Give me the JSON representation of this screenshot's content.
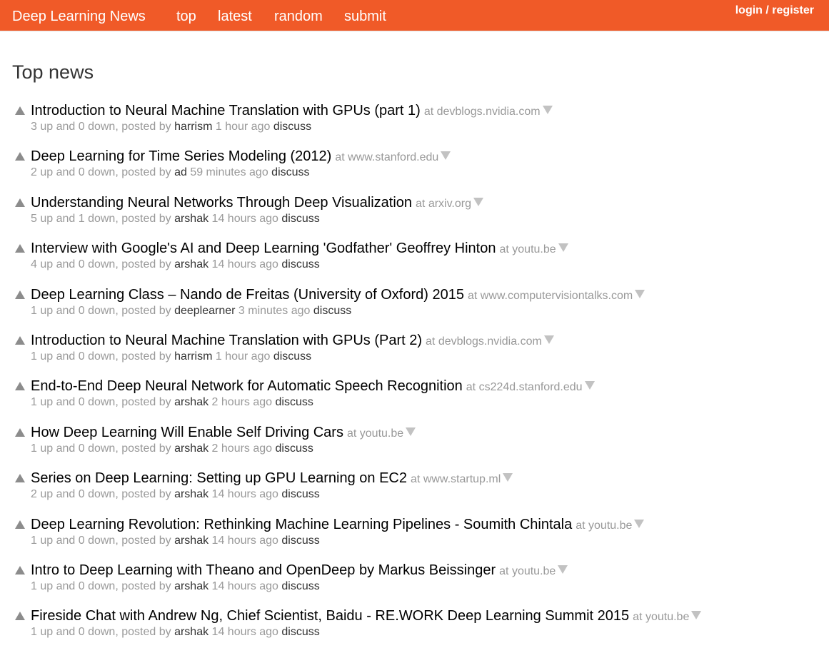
{
  "header": {
    "brand": "Deep Learning News",
    "nav": {
      "top": "top",
      "latest": "latest",
      "random": "random",
      "submit": "submit"
    },
    "login": "login",
    "separator": " / ",
    "register": "register"
  },
  "main": {
    "title": "Top news"
  },
  "labels": {
    "at": "at",
    "posted_by": "posted by",
    "discuss": "discuss"
  },
  "news": [
    {
      "title": "Introduction to Neural Machine Translation with GPUs (part 1)",
      "site": "devblogs.nvidia.com",
      "votes": "3 up and 0 down,",
      "user": "harrism",
      "time": "1 hour ago"
    },
    {
      "title": "Deep Learning for Time Series Modeling (2012)",
      "site": "www.stanford.edu",
      "votes": "2 up and 0 down,",
      "user": "ad",
      "time": "59 minutes ago"
    },
    {
      "title": "Understanding Neural Networks Through Deep Visualization",
      "site": "arxiv.org",
      "votes": "5 up and 1 down,",
      "user": "arshak",
      "time": "14 hours ago"
    },
    {
      "title": "Interview with Google's AI and Deep Learning 'Godfather' Geoffrey Hinton",
      "site": "youtu.be",
      "votes": "4 up and 0 down,",
      "user": "arshak",
      "time": "14 hours ago"
    },
    {
      "title": "Deep Learning Class – Nando de Freitas (University of Oxford) 2015",
      "site": "www.computervisiontalks.com",
      "votes": "1 up and 0 down,",
      "user": "deeplearner",
      "time": "3 minutes ago"
    },
    {
      "title": "Introduction to Neural Machine Translation with GPUs (Part 2)",
      "site": "devblogs.nvidia.com",
      "votes": "1 up and 0 down,",
      "user": "harrism",
      "time": "1 hour ago"
    },
    {
      "title": "End-to-End Deep Neural Network for Automatic Speech Recognition",
      "site": "cs224d.stanford.edu",
      "votes": "1 up and 0 down,",
      "user": "arshak",
      "time": "2 hours ago"
    },
    {
      "title": "How Deep Learning Will Enable Self Driving Cars",
      "site": "youtu.be",
      "votes": "1 up and 0 down,",
      "user": "arshak",
      "time": "2 hours ago"
    },
    {
      "title": "Series on Deep Learning: Setting up GPU Learning on EC2",
      "site": "www.startup.ml",
      "votes": "2 up and 0 down,",
      "user": "arshak",
      "time": "14 hours ago"
    },
    {
      "title": "Deep Learning Revolution: Rethinking Machine Learning Pipelines - Soumith Chintala",
      "site": "youtu.be",
      "votes": "1 up and 0 down,",
      "user": "arshak",
      "time": "14 hours ago"
    },
    {
      "title": "Intro to Deep Learning with Theano and OpenDeep by Markus Beissinger",
      "site": "youtu.be",
      "votes": "1 up and 0 down,",
      "user": "arshak",
      "time": "14 hours ago"
    },
    {
      "title": "Fireside Chat with Andrew Ng, Chief Scientist, Baidu - RE.WORK Deep Learning Summit 2015",
      "site": "youtu.be",
      "votes": "1 up and 0 down,",
      "user": "arshak",
      "time": "14 hours ago"
    }
  ]
}
